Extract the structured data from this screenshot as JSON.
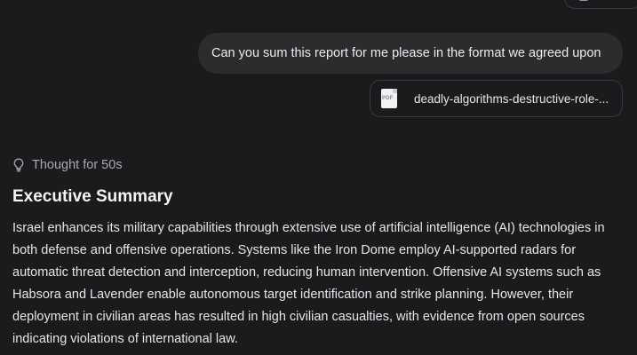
{
  "user_message": {
    "text": "Can you sum this report for me please in the format we agreed upon"
  },
  "attachment": {
    "icon": "pdf-file-icon",
    "icon_label": "PDF",
    "filename": "deadly-algorithms-destructive-role-..."
  },
  "assistant": {
    "thought_label": "Thought for 50s",
    "thought_icon": "lightbulb-icon",
    "heading": "Executive Summary",
    "body": "Israel enhances its military capabilities through extensive use of artificial intelligence (AI) technologies in both defense and offensive operations. Systems like the Iron Dome employ AI-supported radars for automatic threat detection and interception, reducing human intervention. Offensive AI systems such as Habsora and Lavender enable autonomous target identification and strike planning. However, their deployment in civilian areas has resulted in high civilian casualties, with evidence from open sources indicating violations of international law."
  },
  "colors": {
    "background": "#1b1b1d",
    "user_bubble": "#2c2c2f",
    "border": "#3a3a3e",
    "muted_text": "#a9a9ae"
  }
}
